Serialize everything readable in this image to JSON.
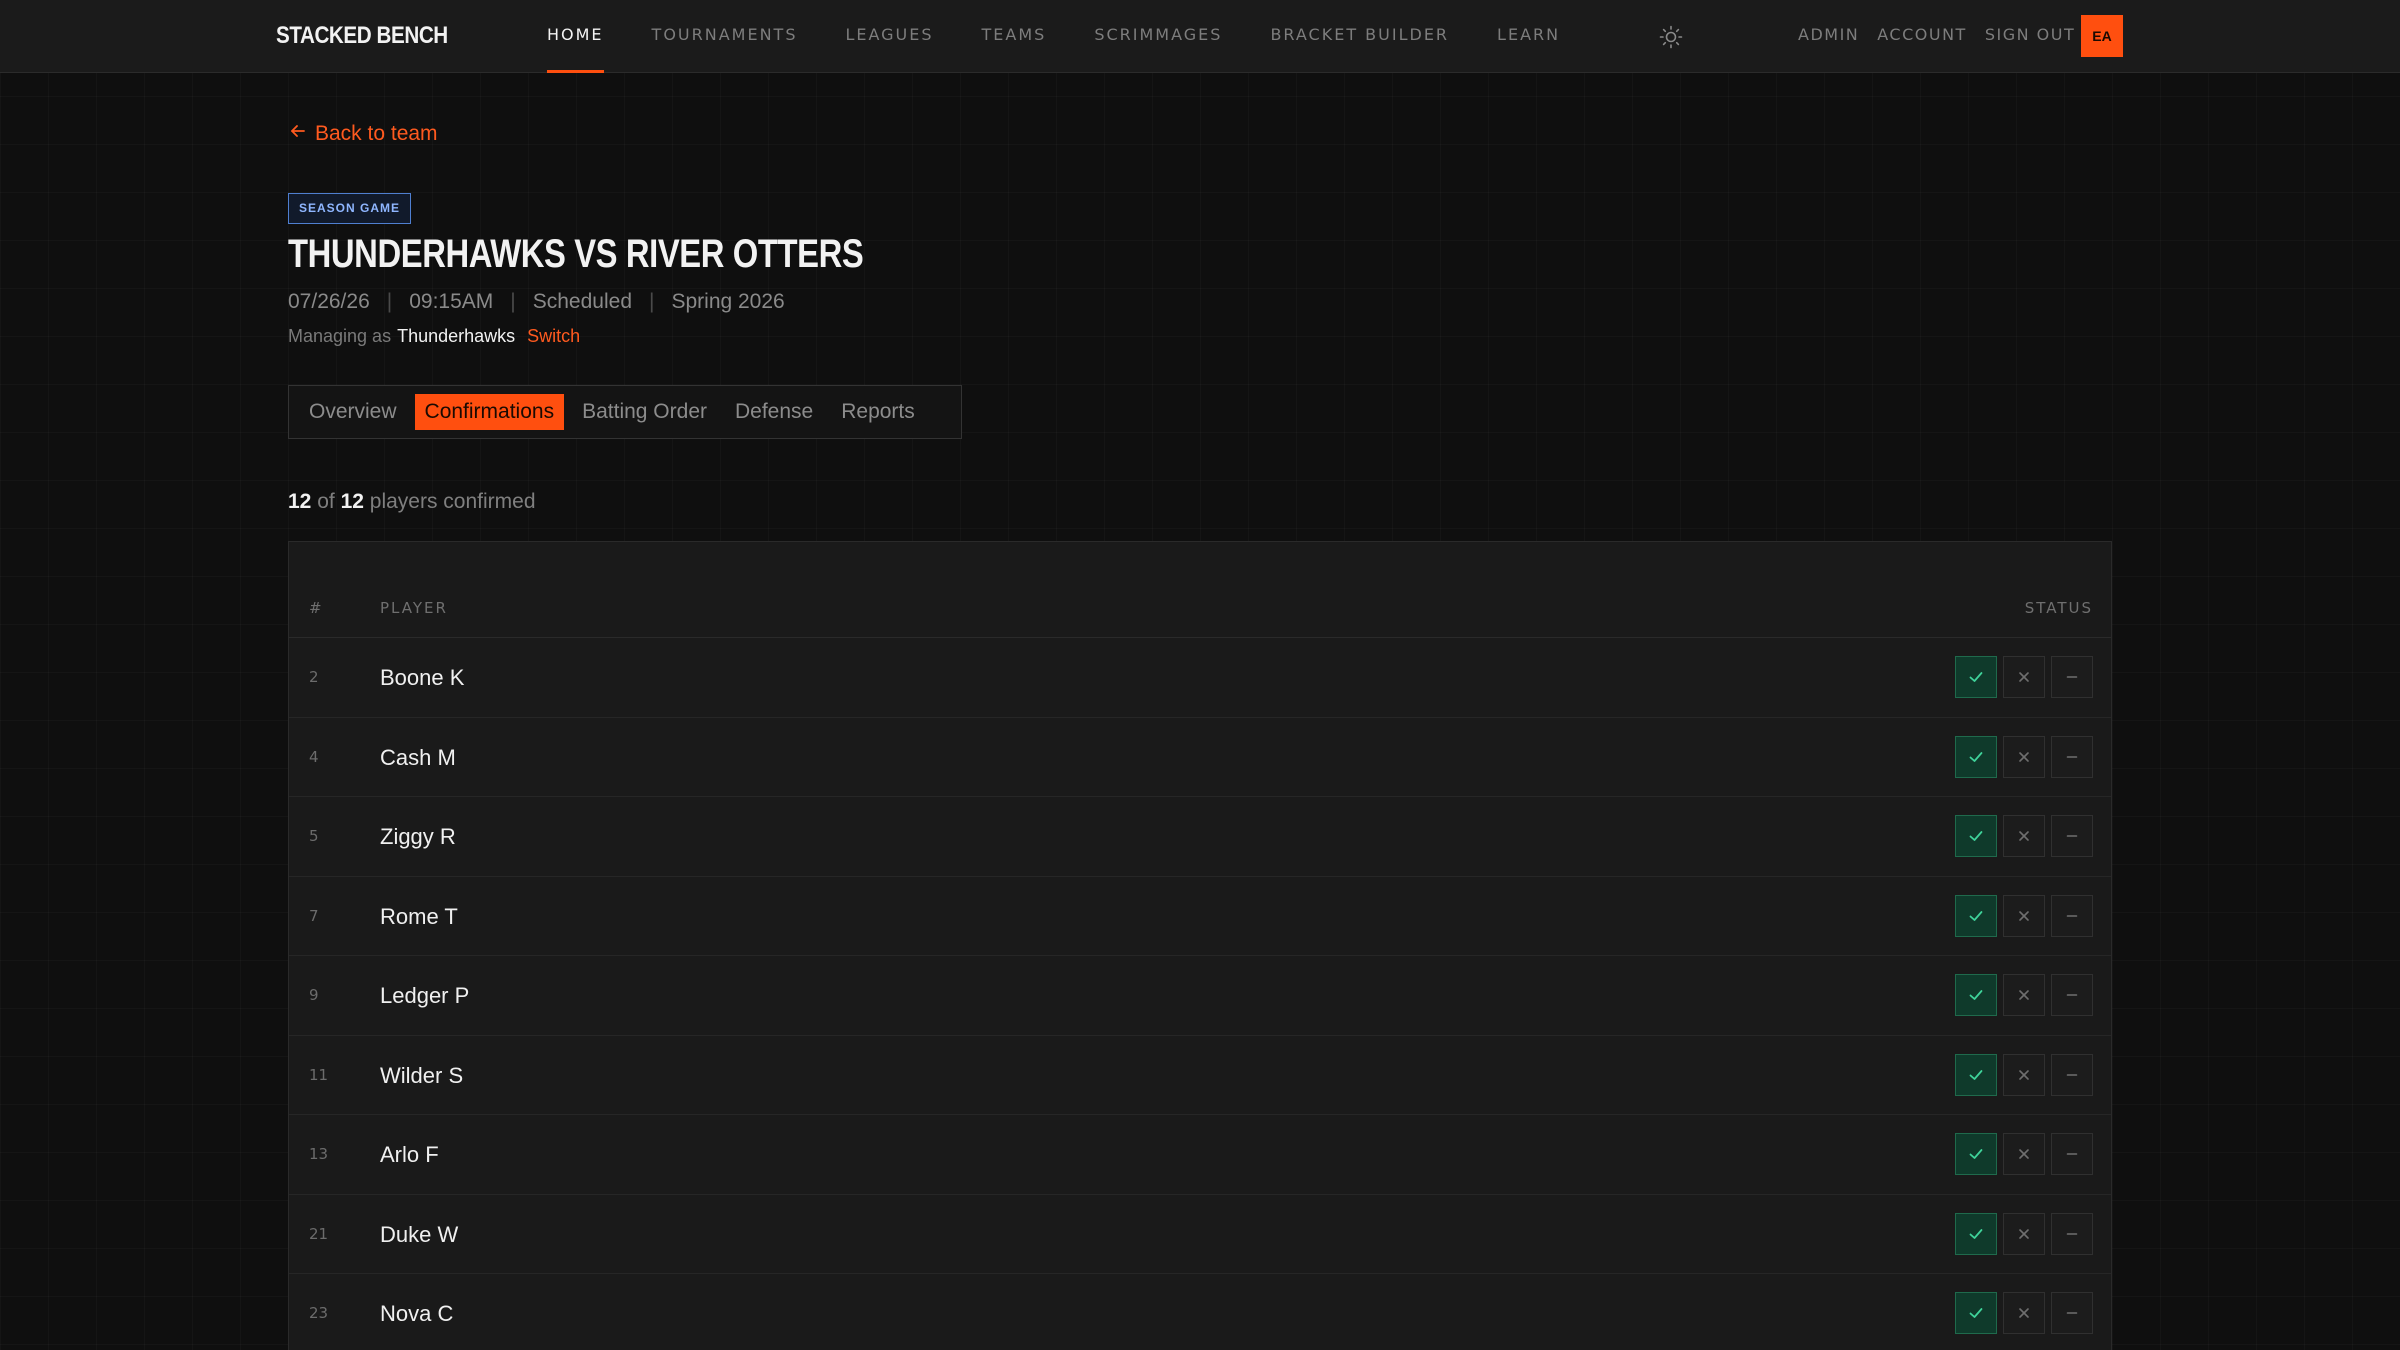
{
  "brand": {
    "logo": "STACKED BENCH",
    "accent": "#ff4f0f"
  },
  "nav": {
    "items": [
      {
        "label": "HOME",
        "active": true
      },
      {
        "label": "TOURNAMENTS"
      },
      {
        "label": "LEAGUES"
      },
      {
        "label": "TEAMS"
      },
      {
        "label": "SCRIMMAGES"
      },
      {
        "label": "BRACKET BUILDER"
      },
      {
        "label": "LEARN"
      }
    ],
    "theme_icon": "sun-icon",
    "right": [
      {
        "label": "ADMIN"
      },
      {
        "label": "ACCOUNT"
      },
      {
        "label": "SIGN OUT"
      }
    ],
    "avatar_initials": "EA"
  },
  "page": {
    "back_label": "Back to team",
    "badge": "SEASON GAME",
    "title": "THUNDERHAWKS VS RIVER OTTERS",
    "date": "07/26/26",
    "time": "09:15AM",
    "status": "Scheduled",
    "season": "Spring 2026",
    "managing_prefix": "Managing as",
    "managing_team": "Thunderhawks",
    "switch_label": "Switch"
  },
  "tabs": [
    {
      "label": "Overview"
    },
    {
      "label": "Confirmations",
      "active": true
    },
    {
      "label": "Batting Order"
    },
    {
      "label": "Defense"
    },
    {
      "label": "Reports"
    }
  ],
  "summary": {
    "confirmed": "12",
    "of": "of",
    "total": "12",
    "suffix": "players confirmed"
  },
  "table": {
    "headers": {
      "num": "#",
      "player": "PLAYER",
      "status": "STATUS"
    },
    "rows": [
      {
        "num": "2",
        "name": "Boone K",
        "status": "confirmed"
      },
      {
        "num": "4",
        "name": "Cash M",
        "status": "confirmed"
      },
      {
        "num": "5",
        "name": "Ziggy R",
        "status": "confirmed"
      },
      {
        "num": "7",
        "name": "Rome T",
        "status": "confirmed"
      },
      {
        "num": "9",
        "name": "Ledger P",
        "status": "confirmed"
      },
      {
        "num": "11",
        "name": "Wilder S",
        "status": "confirmed"
      },
      {
        "num": "13",
        "name": "Arlo F",
        "status": "confirmed"
      },
      {
        "num": "21",
        "name": "Duke W",
        "status": "confirmed"
      },
      {
        "num": "23",
        "name": "Nova C",
        "status": "confirmed"
      }
    ],
    "status_icons": [
      "check-icon",
      "x-icon",
      "dash-icon"
    ]
  }
}
